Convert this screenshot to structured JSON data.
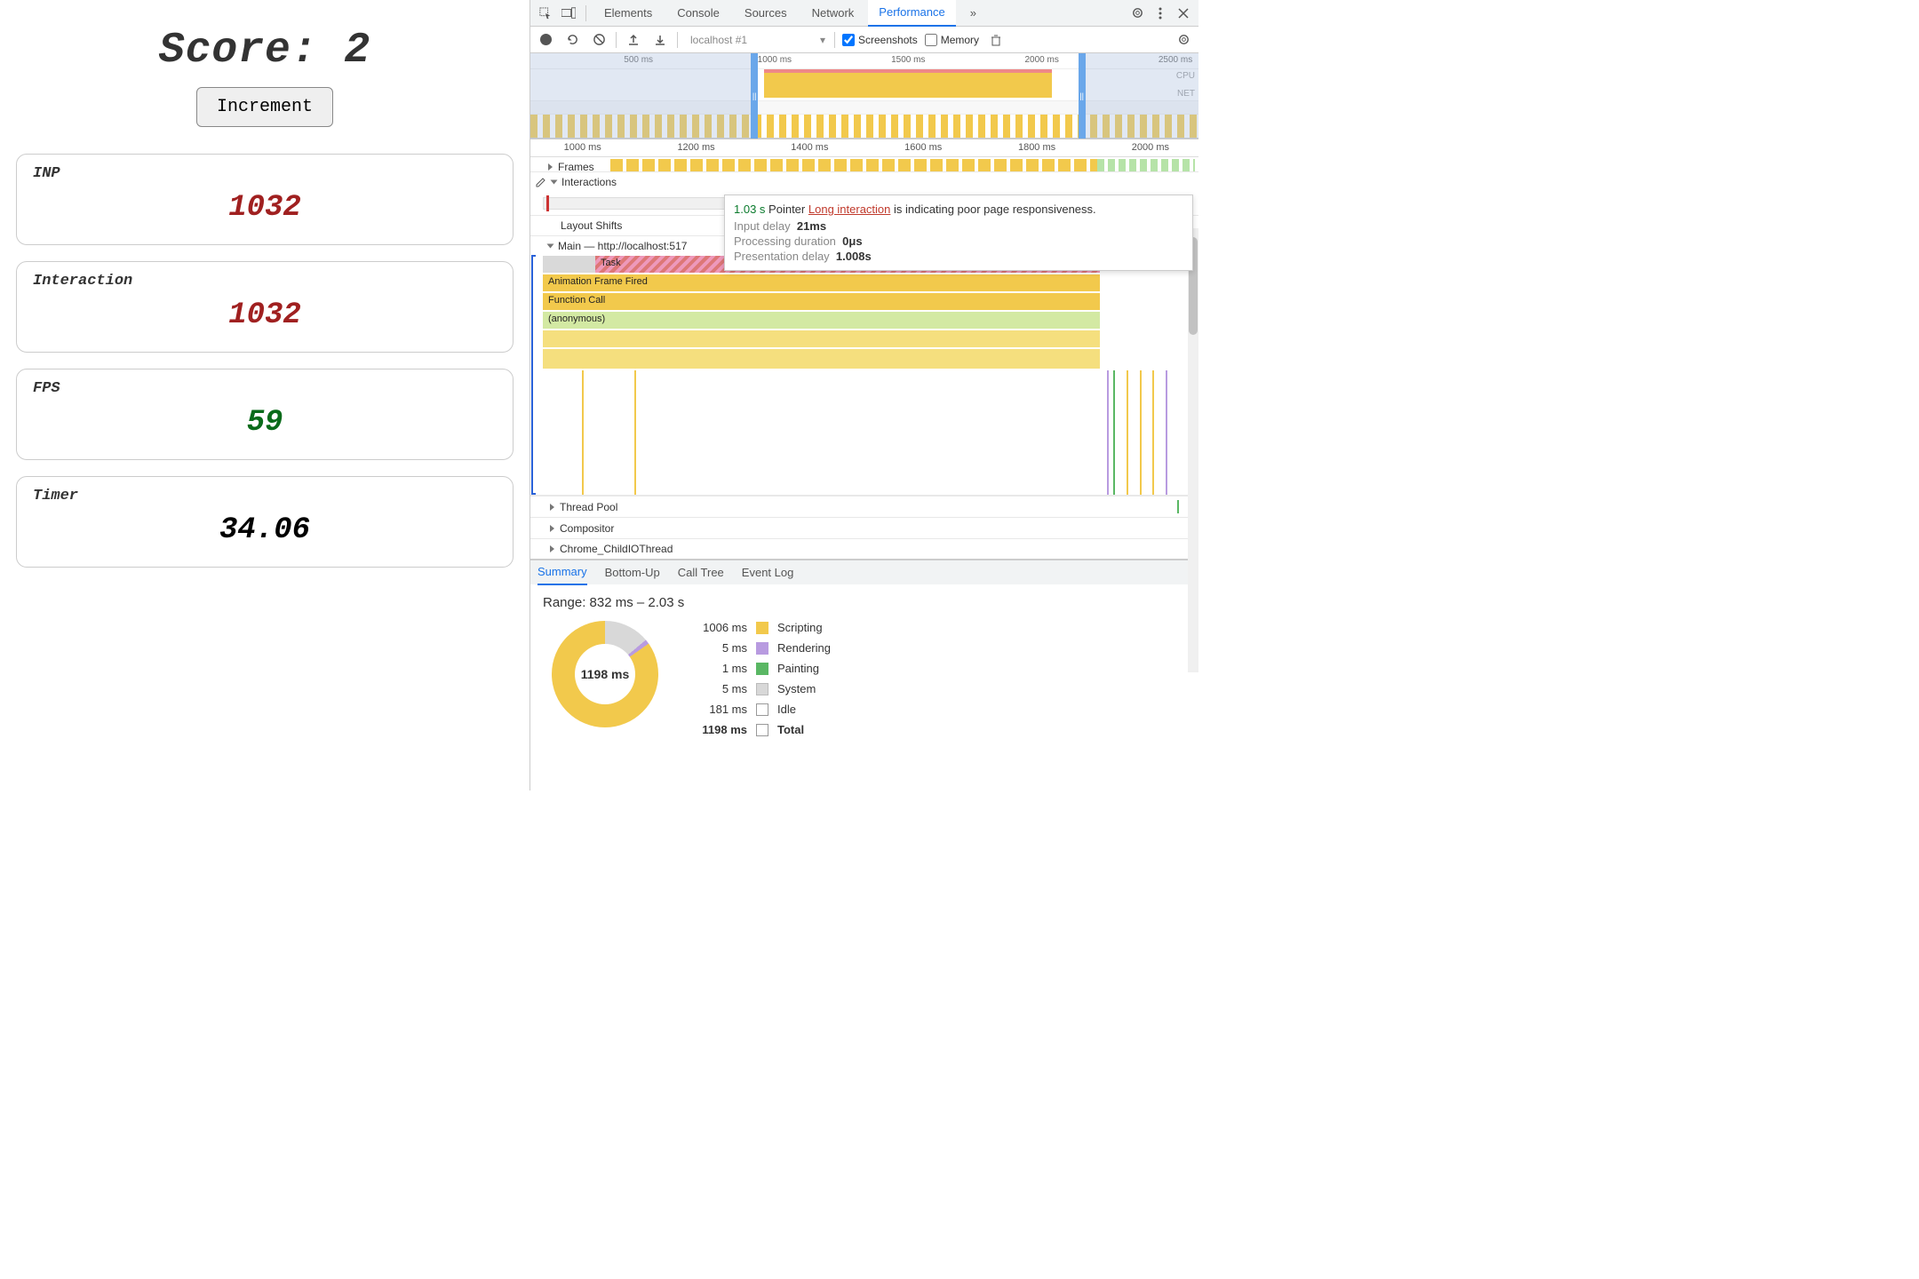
{
  "app": {
    "score_label": "Score: 2",
    "increment_label": "Increment",
    "cards": {
      "inp": {
        "label": "INP",
        "value": "1032",
        "color": "red"
      },
      "interaction": {
        "label": "Interaction",
        "value": "1032",
        "color": "red"
      },
      "fps": {
        "label": "FPS",
        "value": "59",
        "color": "green"
      },
      "timer": {
        "label": "Timer",
        "value": "34.06",
        "color": "black"
      }
    }
  },
  "devtools": {
    "tabs": [
      "Elements",
      "Console",
      "Sources",
      "Network",
      "Performance"
    ],
    "active_tab": "Performance",
    "more_tabs": "»",
    "toolbar": {
      "session_dropdown": "localhost #1",
      "screenshots_label": "Screenshots",
      "screenshots_checked": true,
      "memory_label": "Memory",
      "memory_checked": false
    },
    "overview": {
      "ticks": [
        "500 ms",
        "1000 ms",
        "1500 ms",
        "2000 ms",
        "2500 ms"
      ],
      "labels": {
        "cpu": "CPU",
        "net": "NET"
      }
    },
    "flame": {
      "ruler": [
        "1000 ms",
        "1200 ms",
        "1400 ms",
        "1600 ms",
        "1800 ms",
        "2000 ms"
      ],
      "tracks": {
        "frames": "Frames",
        "interactions": "Interactions",
        "layout_shifts": "Layout Shifts",
        "main": "Main — http://localhost:517",
        "task": "Task",
        "anim_frame": "Animation Frame Fired",
        "func_call": "Function Call",
        "anon": "(anonymous)",
        "thread_pool": "Thread Pool",
        "compositor": "Compositor",
        "child_io": "Chrome_ChildIOThread"
      }
    },
    "tooltip": {
      "duration": "1.03 s",
      "kind": "Pointer",
      "link_text": "Long interaction",
      "suffix": " is indicating poor page responsiveness.",
      "rows": [
        {
          "label": "Input delay",
          "value": "21ms"
        },
        {
          "label": "Processing duration",
          "value": "0μs"
        },
        {
          "label": "Presentation delay",
          "value": "1.008s"
        }
      ]
    },
    "bottom_tabs": [
      "Summary",
      "Bottom-Up",
      "Call Tree",
      "Event Log"
    ],
    "active_bottom_tab": "Summary",
    "summary": {
      "range": "Range: 832 ms – 2.03 s",
      "center": "1198 ms",
      "legend": [
        {
          "ms": "1006 ms",
          "swatch": "sw-y",
          "label": "Scripting"
        },
        {
          "ms": "5 ms",
          "swatch": "sw-p",
          "label": "Rendering"
        },
        {
          "ms": "1 ms",
          "swatch": "sw-g",
          "label": "Painting"
        },
        {
          "ms": "5 ms",
          "swatch": "sw-gr",
          "label": "System"
        },
        {
          "ms": "181 ms",
          "swatch": "sw-w",
          "label": "Idle"
        },
        {
          "ms": "1198 ms",
          "swatch": "sw-w",
          "label": "Total",
          "bold": true
        }
      ]
    }
  },
  "chart_data": {
    "type": "pie",
    "title": "Time breakdown",
    "categories": [
      "Scripting",
      "Rendering",
      "Painting",
      "System",
      "Idle"
    ],
    "values": [
      1006,
      5,
      1,
      5,
      181
    ],
    "total": 1198,
    "unit": "ms"
  }
}
